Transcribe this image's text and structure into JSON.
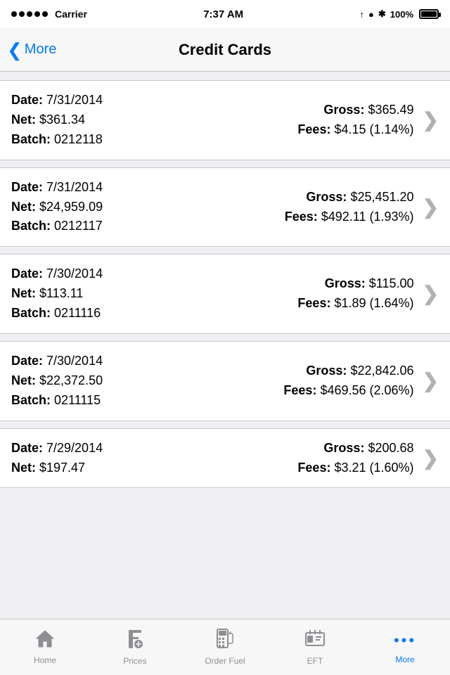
{
  "statusBar": {
    "carrier": "Carrier",
    "time": "7:37 AM",
    "battery": "100%"
  },
  "navBar": {
    "backLabel": "More",
    "title": "Credit Cards"
  },
  "rows": [
    {
      "date": "7/31/2014",
      "net": "$361.34",
      "batch": "0212118",
      "gross": "$365.49",
      "fees": "$4.15 (1.14%)"
    },
    {
      "date": "7/31/2014",
      "net": "$24,959.09",
      "batch": "0212117",
      "gross": "$25,451.20",
      "fees": "$492.11 (1.93%)"
    },
    {
      "date": "7/30/2014",
      "net": "$113.11",
      "batch": "0211116",
      "gross": "$115.00",
      "fees": "$1.89 (1.64%)"
    },
    {
      "date": "7/30/2014",
      "net": "$22,372.50",
      "batch": "0211115",
      "gross": "$22,842.06",
      "fees": "$469.56 (2.06%)"
    },
    {
      "date": "7/29/2014",
      "net": "$197.47",
      "batch": "",
      "gross": "$200.68",
      "fees": "$3.21 (1.60%)"
    }
  ],
  "tabBar": {
    "items": [
      {
        "id": "home",
        "label": "Home",
        "active": false
      },
      {
        "id": "prices",
        "label": "Prices",
        "active": false
      },
      {
        "id": "order-fuel",
        "label": "Order Fuel",
        "active": false
      },
      {
        "id": "eft",
        "label": "EFT",
        "active": false
      },
      {
        "id": "more",
        "label": "More",
        "active": true
      }
    ]
  },
  "labels": {
    "date_prefix": "Date:",
    "net_prefix": "Net:",
    "batch_prefix": "Batch:",
    "gross_prefix": "Gross:",
    "fees_prefix": "Fees:"
  }
}
